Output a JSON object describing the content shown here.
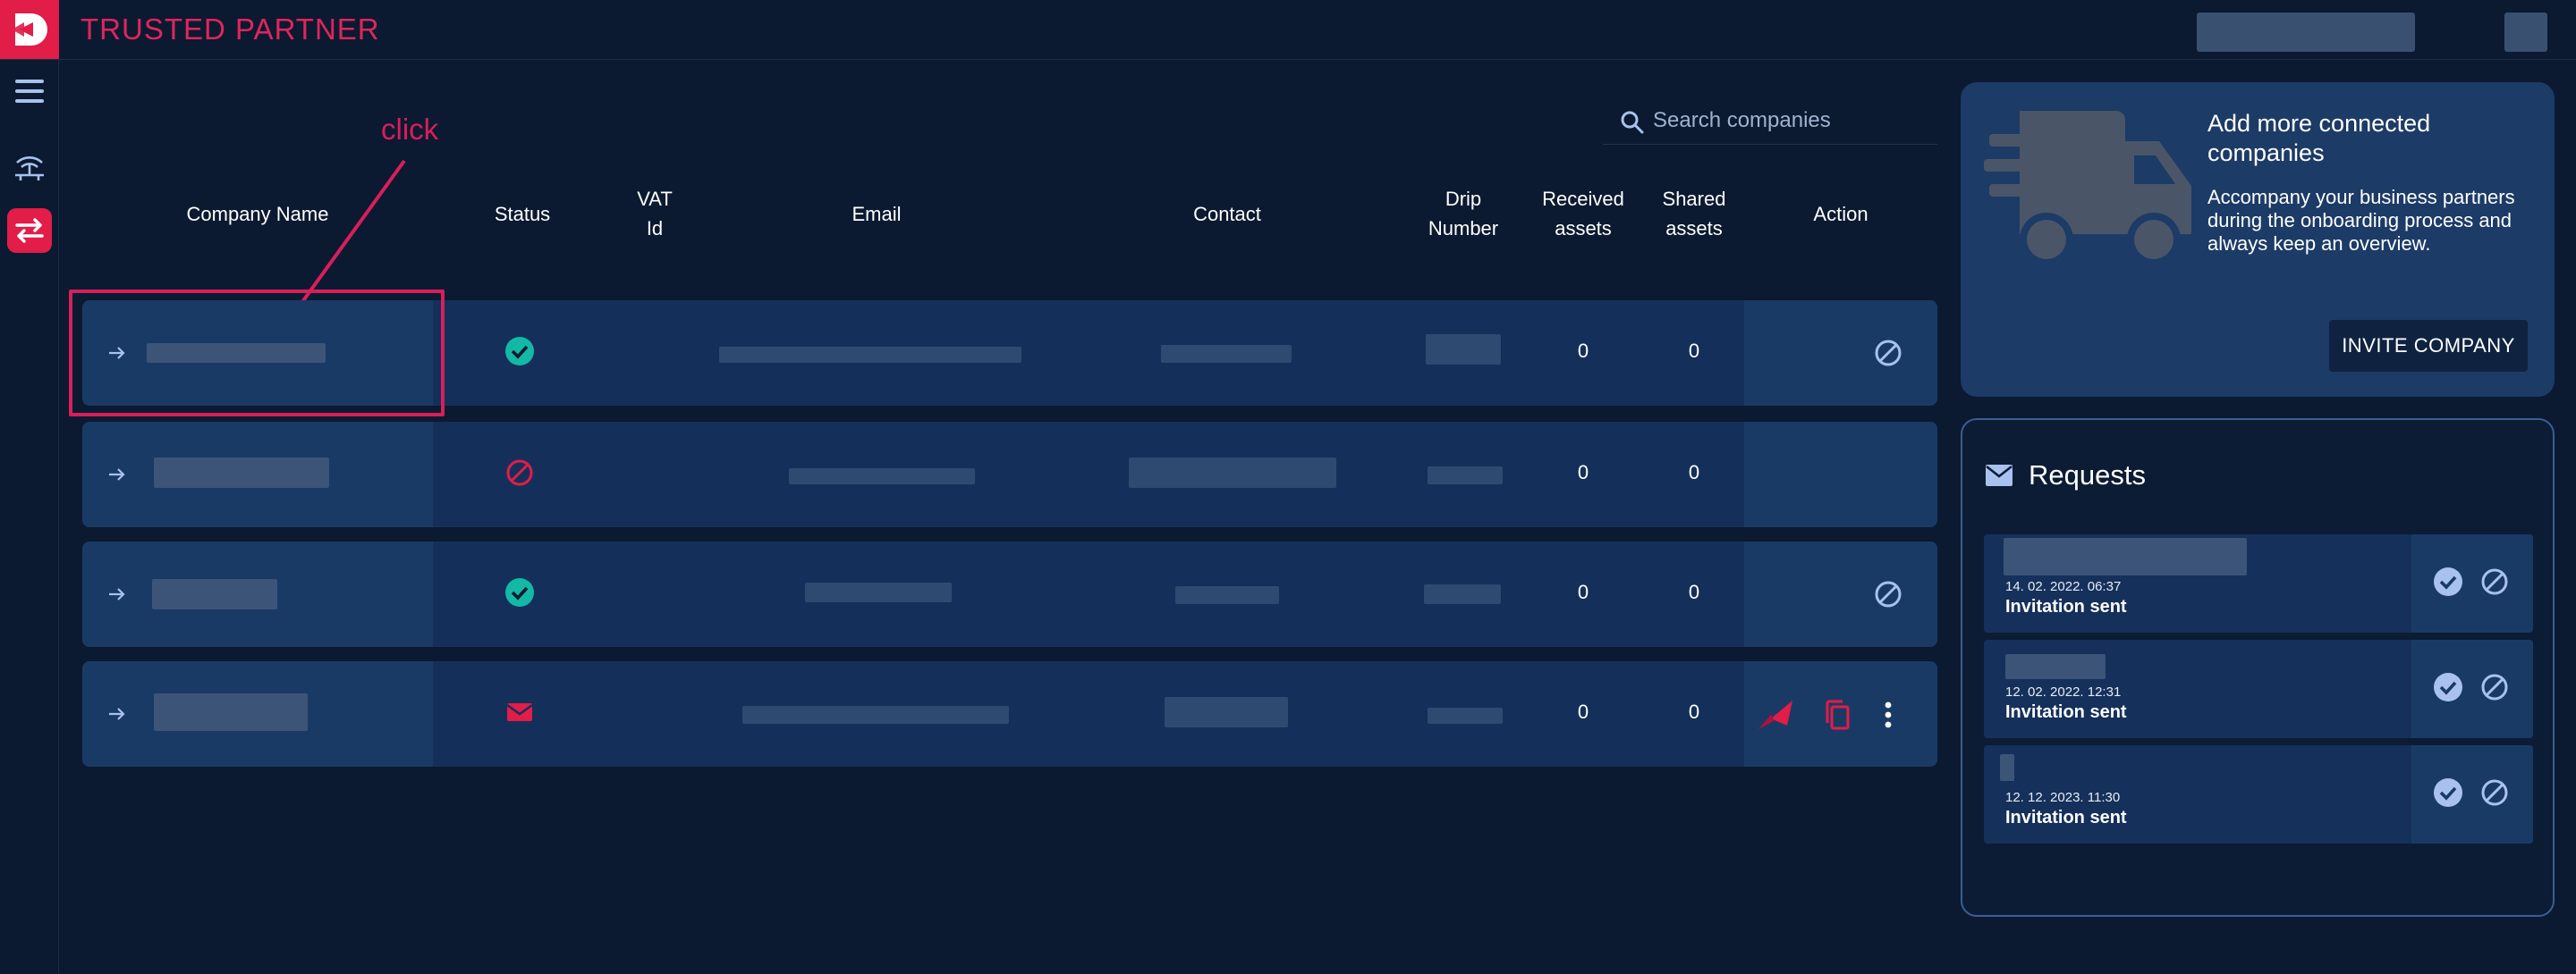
{
  "app": {
    "title": "TRUSTED PARTNER"
  },
  "search": {
    "placeholder": "Search companies"
  },
  "annotation": {
    "label": "click"
  },
  "table": {
    "headers": {
      "company_name": "Company Name",
      "status": "Status",
      "vat_id": "VAT\nId",
      "email": "Email",
      "contact": "Contact",
      "drip_number": "Drip\nNumber",
      "received_assets": "Received\nassets",
      "shared_assets": "Shared\nassets",
      "action": "Action"
    },
    "rows": [
      {
        "status": "active",
        "received_assets": "0",
        "shared_assets": "0"
      },
      {
        "status": "blocked",
        "received_assets": "0",
        "shared_assets": "0"
      },
      {
        "status": "active",
        "received_assets": "0",
        "shared_assets": "0"
      },
      {
        "status": "invited",
        "received_assets": "0",
        "shared_assets": "0"
      }
    ]
  },
  "promo": {
    "title": "Add more connected companies",
    "text": "Accompany your business partners during the onboarding process and always keep an overview.",
    "button_label": "INVITE COMPANY"
  },
  "requests": {
    "title": "Requests",
    "items": [
      {
        "date": "14. 02. 2022. 06:37",
        "status": "Invitation sent"
      },
      {
        "date": "12. 02. 2022. 12:31",
        "status": "Invitation sent"
      },
      {
        "date": "12. 12. 2023. 11:30",
        "status": "Invitation sent"
      }
    ]
  },
  "colors": {
    "background": "#0b1a30",
    "accent": "#e11d48",
    "row_bg": "#14305a",
    "success": "#14b8a6",
    "icon_light": "#a9c1ee"
  }
}
